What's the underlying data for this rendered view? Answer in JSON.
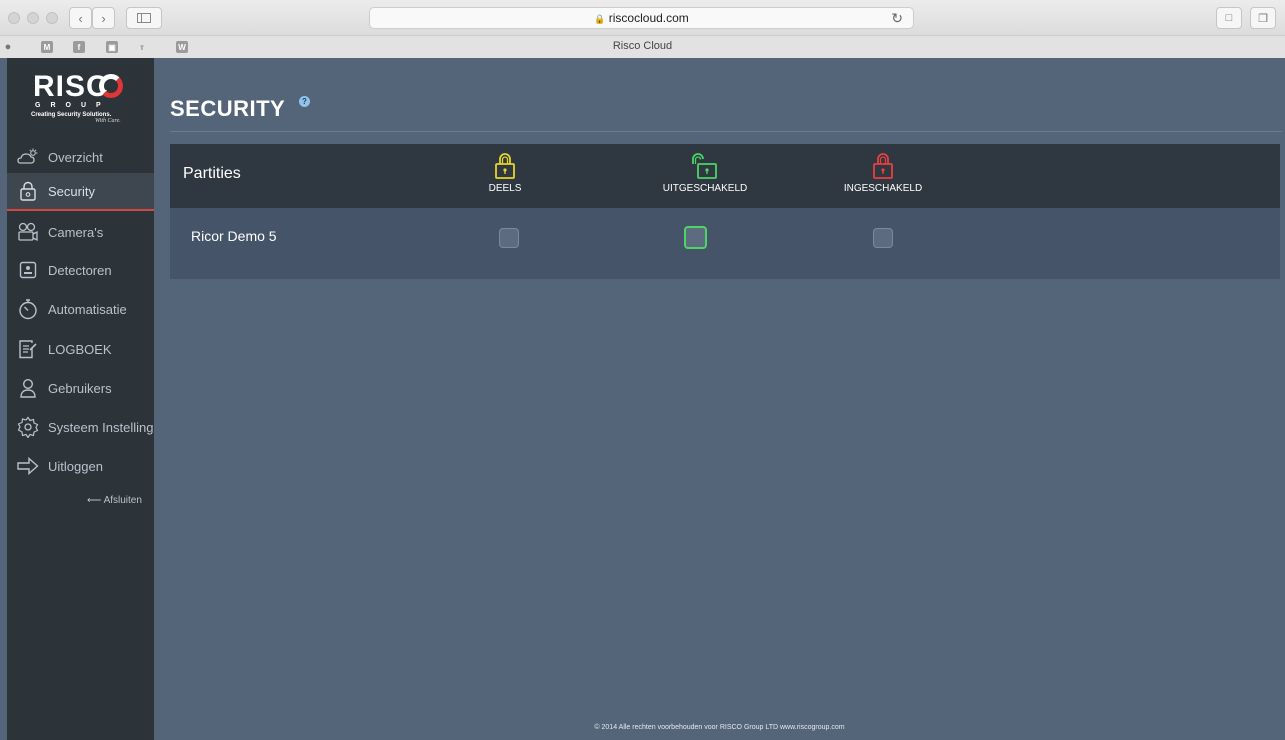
{
  "browser": {
    "url": "riscocloud.com",
    "tab_title": "Risco Cloud",
    "bookmarks": [
      "M",
      "",
      "",
      "",
      "W"
    ]
  },
  "logo": {
    "word": "RISC",
    "group": "GROUP",
    "tagline": "Creating Security Solutions.",
    "care": "With Care."
  },
  "sidebar": {
    "items": [
      {
        "label": "Overzicht",
        "icon": "cloud-sun-icon"
      },
      {
        "label": "Security",
        "icon": "padlock-icon"
      },
      {
        "label": "Camera's",
        "icon": "camera-icon"
      },
      {
        "label": "Detectoren",
        "icon": "detector-icon"
      },
      {
        "label": "Automatisatie",
        "icon": "timer-icon"
      },
      {
        "label": "LOGBOEK",
        "icon": "logbook-icon"
      },
      {
        "label": "Gebruikers",
        "icon": "user-icon"
      },
      {
        "label": "Systeem Instellingen",
        "icon": "gear-icon"
      },
      {
        "label": "Uitloggen",
        "icon": "logout-arrow-icon"
      }
    ],
    "close_label": "⟵ Afsluiten"
  },
  "main": {
    "title": "SECURITY",
    "help": "?",
    "panel_title": "Partities",
    "states": [
      {
        "label": "DEELS",
        "color": "#e6d52a"
      },
      {
        "label": "UITGESCHAKELD",
        "color": "#4cd466"
      },
      {
        "label": "INGESCHAKELD",
        "color": "#e8403e"
      }
    ],
    "partitions": [
      {
        "name": "Ricor Demo 5",
        "deels": false,
        "uitgeschakeld": true,
        "ingeschakeld": false
      }
    ]
  },
  "footer": "© 2014 Alle rechten voorbehouden voor RISCO Group LTD  www.riscogroup.com"
}
